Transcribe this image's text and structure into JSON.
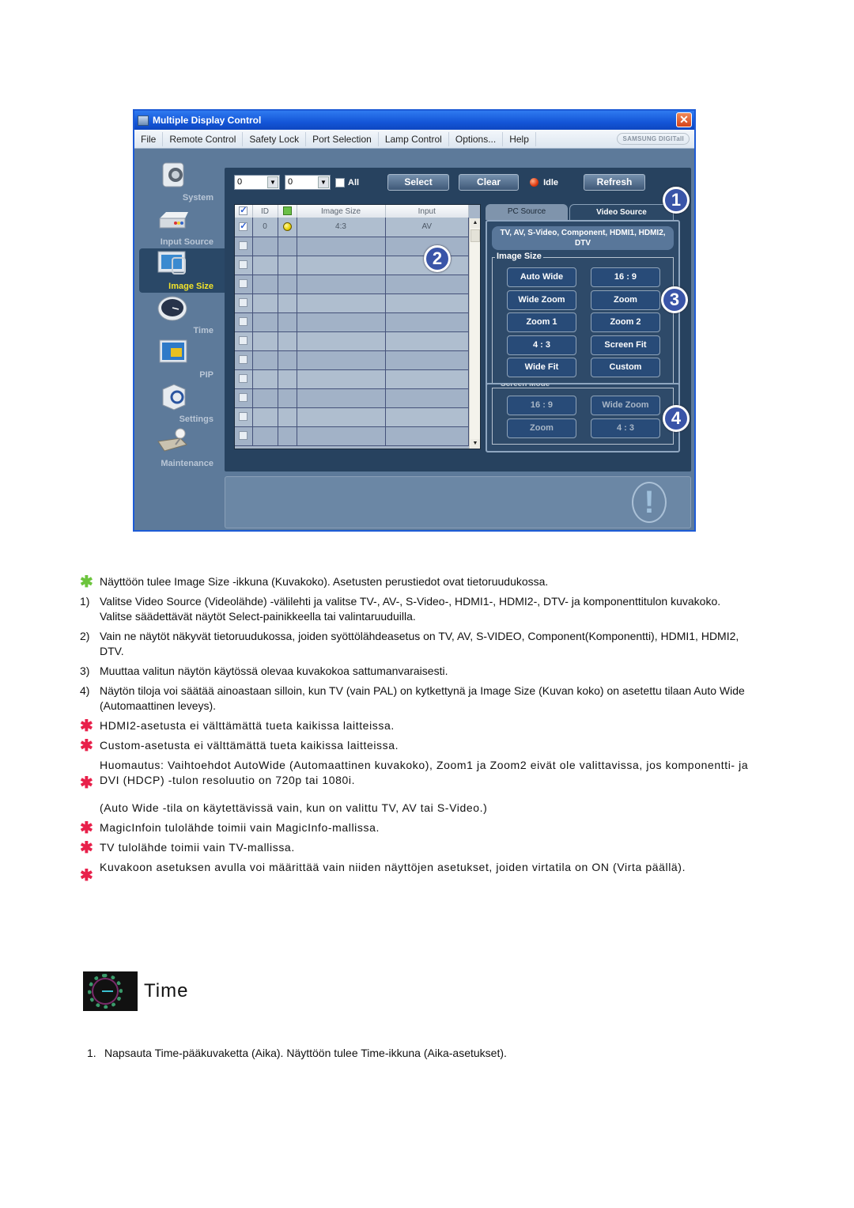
{
  "window": {
    "title": "Multiple Display Control",
    "close_label": "✕",
    "menu": [
      "File",
      "Remote Control",
      "Safety Lock",
      "Port Selection",
      "Lamp Control",
      "Options...",
      "Help"
    ],
    "brand": "SAMSUNG DIGITall"
  },
  "sidebar": {
    "items": [
      {
        "label": "System",
        "icon": "system-icon",
        "active": false
      },
      {
        "label": "Input Source",
        "icon": "input-source-icon",
        "active": false
      },
      {
        "label": "Image Size",
        "icon": "image-size-icon",
        "active": true
      },
      {
        "label": "Time",
        "icon": "clock-icon",
        "active": false
      },
      {
        "label": "PIP",
        "icon": "pip-icon",
        "active": false
      },
      {
        "label": "Settings",
        "icon": "settings-icon",
        "active": false
      },
      {
        "label": "Maintenance",
        "icon": "maintenance-icon",
        "active": false
      }
    ]
  },
  "toolbar": {
    "combo1_value": "0",
    "combo2_value": "0",
    "all_label": "All",
    "select_label": "Select",
    "clear_label": "Clear",
    "status_label": "Idle",
    "refresh_label": "Refresh"
  },
  "grid": {
    "headers": [
      "",
      "ID",
      "",
      "Image Size",
      "Input"
    ],
    "rows": [
      {
        "checked": true,
        "id": "0",
        "power": "on",
        "image_size": "4:3",
        "input": "AV"
      },
      {
        "checked": false,
        "id": "",
        "power": "",
        "image_size": "",
        "input": ""
      },
      {
        "checked": false,
        "id": "",
        "power": "",
        "image_size": "",
        "input": ""
      },
      {
        "checked": false,
        "id": "",
        "power": "",
        "image_size": "",
        "input": ""
      },
      {
        "checked": false,
        "id": "",
        "power": "",
        "image_size": "",
        "input": ""
      },
      {
        "checked": false,
        "id": "",
        "power": "",
        "image_size": "",
        "input": ""
      },
      {
        "checked": false,
        "id": "",
        "power": "",
        "image_size": "",
        "input": ""
      },
      {
        "checked": false,
        "id": "",
        "power": "",
        "image_size": "",
        "input": ""
      },
      {
        "checked": false,
        "id": "",
        "power": "",
        "image_size": "",
        "input": ""
      },
      {
        "checked": false,
        "id": "",
        "power": "",
        "image_size": "",
        "input": ""
      },
      {
        "checked": false,
        "id": "",
        "power": "",
        "image_size": "",
        "input": ""
      },
      {
        "checked": false,
        "id": "",
        "power": "",
        "image_size": "",
        "input": ""
      }
    ]
  },
  "source_tabs": {
    "pc_label": "PC Source",
    "video_label": "Video Source",
    "sources_text": "TV, AV, S-Video, Component, HDMI1, HDMI2, DTV",
    "image_size_legend": "Image Size",
    "image_size_buttons": [
      "Auto Wide",
      "16 : 9",
      "Wide Zoom",
      "Zoom",
      "Zoom 1",
      "Zoom 2",
      "4 : 3",
      "Screen Fit",
      "Wide Fit",
      "Custom"
    ],
    "screen_mode_legend": "Screen Mode",
    "screen_mode_buttons": [
      "16 : 9",
      "Wide Zoom",
      "Zoom",
      "4 : 3"
    ]
  },
  "callouts": [
    "1",
    "2",
    "3",
    "4"
  ],
  "doc": {
    "intro": "Näyttöön tulee Image Size -ikkuna (Kuvakoko). Asetusten perustiedot ovat tietoruudukossa.",
    "steps": [
      {
        "num": "1)",
        "text": "Valitse Video Source (Videolähde) -välilehti ja valitse TV-, AV-, S-Video-, HDMI1-, HDMI2-, DTV- ja komponenttitulon kuvakoko.",
        "extra": "Valitse säädettävät näytöt Select-painikkeella tai valintaruuduilla."
      },
      {
        "num": "2)",
        "text": "Vain ne näytöt näkyvät tietoruudukossa, joiden syöttölähdeasetus on TV, AV, S-VIDEO, Component(Komponentti), HDMI1, HDMI2, DTV."
      },
      {
        "num": "3)",
        "text": "Muuttaa valitun näytön käytössä olevaa kuvakokoa sattumanvaraisesti."
      },
      {
        "num": "4)",
        "text": "Näytön tiloja voi säätää ainoastaan silloin, kun TV (vain PAL) on kytkettynä ja Image Size (Kuvan koko) on asetettu tilaan Auto Wide (Automaattinen leveys)."
      }
    ],
    "notes": [
      "HDMI2-asetusta ei välttämättä tueta kaikissa laitteissa.",
      "Custom-asetusta ei välttämättä tueta kaikissa laitteissa.",
      "Huomautus: Vaihtoehdot AutoWide (Automaattinen kuvakoko), Zoom1 ja Zoom2 eivät ole valittavissa, jos komponentti- ja DVI (HDCP) -tulon resoluutio on 720p tai 1080i.",
      "(Auto Wide -tila on käytettävissä vain, kun on valittu TV, AV tai S-Video.)",
      "MagicInfoin tulolähde toimii vain MagicInfo-mallissa.",
      "TV tulolähde toimii vain TV-mallissa.",
      "Kuvakoon asetuksen avulla voi määrittää vain niiden näyttöjen asetukset, joiden virtatila on ON (Virta päällä)."
    ],
    "note_mark": "✱",
    "section_title": "Time",
    "section_step": {
      "num": "1.",
      "text": "Napsauta Time-pääkuvaketta (Aika). Näyttöön tulee Time-ikkuna (Aika-asetukset)."
    }
  }
}
